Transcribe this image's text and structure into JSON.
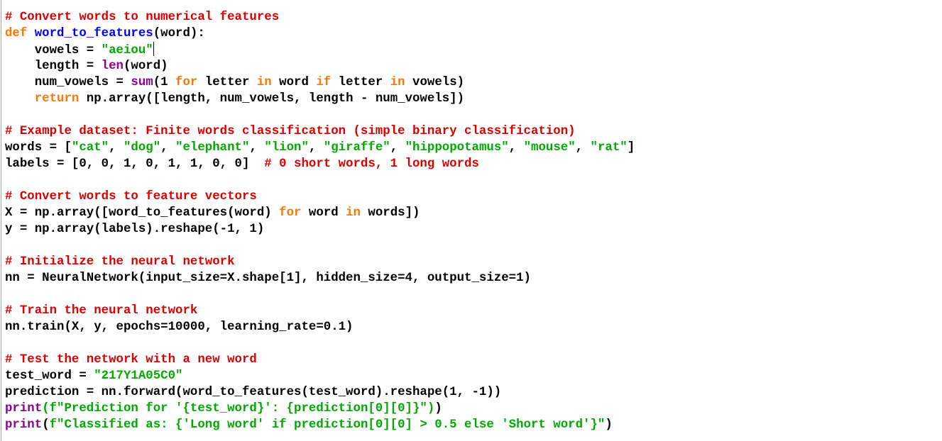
{
  "editor": {
    "colors": {
      "default": "#000000",
      "comment": "#dd0000",
      "keyword": "#ff7700",
      "string": "#00aa00",
      "builtin": "#900090",
      "defname": "#0000ff",
      "background": "#ffffff"
    },
    "lines": [
      [
        {
          "t": "# Convert words to numerical features",
          "c": "comment"
        }
      ],
      [
        {
          "t": "def",
          "c": "keyword"
        },
        {
          "t": " "
        },
        {
          "t": "word_to_features",
          "c": "defname"
        },
        {
          "t": "(word):"
        }
      ],
      [
        {
          "t": "    vowels = "
        },
        {
          "t": "\"aeiou\"",
          "c": "string"
        },
        {
          "caret": true
        }
      ],
      [
        {
          "t": "    length = "
        },
        {
          "t": "len",
          "c": "builtin"
        },
        {
          "t": "(word)"
        }
      ],
      [
        {
          "t": "    num_vowels = "
        },
        {
          "t": "sum",
          "c": "builtin"
        },
        {
          "t": "(1 "
        },
        {
          "t": "for",
          "c": "keyword"
        },
        {
          "t": " letter "
        },
        {
          "t": "in",
          "c": "keyword"
        },
        {
          "t": " word "
        },
        {
          "t": "if",
          "c": "keyword"
        },
        {
          "t": " letter "
        },
        {
          "t": "in",
          "c": "keyword"
        },
        {
          "t": " vowels)"
        }
      ],
      [
        {
          "t": "    "
        },
        {
          "t": "return",
          "c": "keyword"
        },
        {
          "t": " np.array([length, num_vowels, length - num_vowels])"
        }
      ],
      [],
      [
        {
          "t": "# Example dataset: Finite words classification (simple binary classification)",
          "c": "comment"
        }
      ],
      [
        {
          "t": "words = ["
        },
        {
          "t": "\"cat\"",
          "c": "string"
        },
        {
          "t": ", "
        },
        {
          "t": "\"dog\"",
          "c": "string"
        },
        {
          "t": ", "
        },
        {
          "t": "\"elephant\"",
          "c": "string"
        },
        {
          "t": ", "
        },
        {
          "t": "\"lion\"",
          "c": "string"
        },
        {
          "t": ", "
        },
        {
          "t": "\"giraffe\"",
          "c": "string"
        },
        {
          "t": ", "
        },
        {
          "t": "\"hippopotamus\"",
          "c": "string"
        },
        {
          "t": ", "
        },
        {
          "t": "\"mouse\"",
          "c": "string"
        },
        {
          "t": ", "
        },
        {
          "t": "\"rat\"",
          "c": "string"
        },
        {
          "t": "]"
        }
      ],
      [
        {
          "t": "labels = [0, 0, 1, 0, 1, 1, 0, 0]  "
        },
        {
          "t": "# 0 short words, 1 long words",
          "c": "comment"
        }
      ],
      [],
      [
        {
          "t": "# Convert words to feature vectors",
          "c": "comment"
        }
      ],
      [
        {
          "t": "X = np.array([word_to_features(word) "
        },
        {
          "t": "for",
          "c": "keyword"
        },
        {
          "t": " word "
        },
        {
          "t": "in",
          "c": "keyword"
        },
        {
          "t": " words])"
        }
      ],
      [
        {
          "t": "y = np.array(labels).reshape(-1, 1)"
        }
      ],
      [],
      [
        {
          "t": "# Initialize the neural network",
          "c": "comment"
        }
      ],
      [
        {
          "t": "nn = NeuralNetwork(input_size=X.shape[1], hidden_size=4, output_size=1)"
        }
      ],
      [],
      [
        {
          "t": "# Train the neural network",
          "c": "comment"
        }
      ],
      [
        {
          "t": "nn.train(X, y, epochs=10000, learning_rate=0.1)"
        }
      ],
      [],
      [
        {
          "t": "# Test the network with a new word",
          "c": "comment"
        }
      ],
      [
        {
          "t": "test_word = "
        },
        {
          "t": "\"217Y1A05C0\"",
          "c": "string"
        }
      ],
      [
        {
          "t": "prediction = nn.forward(word_to_features(test_word).reshape(1, -1))"
        }
      ],
      [
        {
          "t": "print",
          "c": "builtin"
        },
        {
          "t": "(f\"Prediction for '{test_word}': {prediction[0][0]}\")",
          "c": "string"
        },
        {
          "t": ")"
        }
      ],
      [
        {
          "t": "print",
          "c": "builtin"
        },
        {
          "t": "(",
          "c": "default"
        },
        {
          "t": "f\"Classified as: {'Long word' if prediction[0][0] > 0.5 else 'Short word'}\"",
          "c": "string"
        },
        {
          "t": ")"
        }
      ]
    ]
  }
}
